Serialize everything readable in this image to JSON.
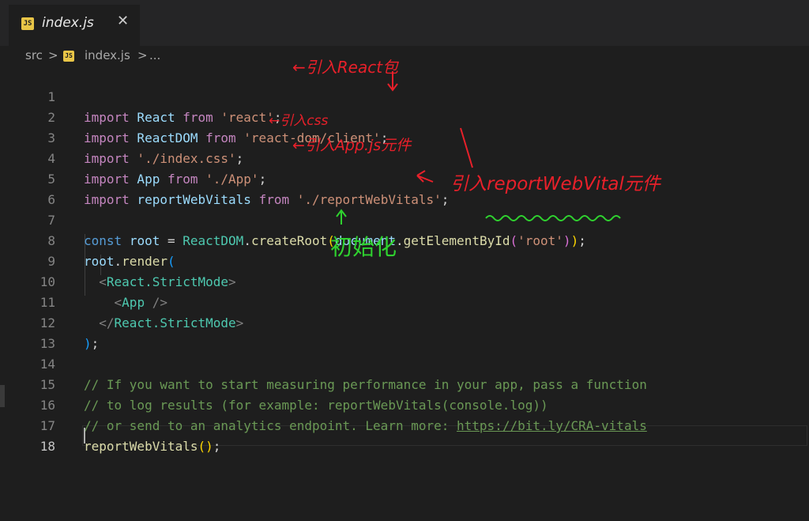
{
  "tab": {
    "badge": "JS",
    "label": "index.js",
    "close": "✕"
  },
  "breadcrumb": {
    "folder": "src",
    "sep1": ">",
    "file": "index.js",
    "sep2": ">",
    "more": "..."
  },
  "lines": [
    {
      "n": "1"
    },
    {
      "n": "2"
    },
    {
      "n": "3"
    },
    {
      "n": "4"
    },
    {
      "n": "5"
    },
    {
      "n": "6"
    },
    {
      "n": "7"
    },
    {
      "n": "8"
    },
    {
      "n": "9"
    },
    {
      "n": "10"
    },
    {
      "n": "11"
    },
    {
      "n": "12"
    },
    {
      "n": "13"
    },
    {
      "n": "14"
    },
    {
      "n": "15"
    },
    {
      "n": "16"
    },
    {
      "n": "17"
    },
    {
      "n": "18"
    }
  ],
  "code": {
    "l1": {
      "kw1": "import",
      "id": " React ",
      "kw2": "from",
      "str": " 'react'",
      "end": ";"
    },
    "l2": {
      "kw1": "import",
      "id": " ReactDOM ",
      "kw2": "from",
      "str": " 'react-dom/client'",
      "end": ";"
    },
    "l3": {
      "kw1": "import",
      "str": " './index.css'",
      "end": ";"
    },
    "l4": {
      "kw1": "import",
      "id": " App ",
      "kw2": "from",
      "str": " './App'",
      "end": ";"
    },
    "l5": {
      "kw1": "import",
      "id": " reportWebVitals ",
      "kw2": "from",
      "str": " './reportWebVitals'",
      "end": ";"
    },
    "l7": {
      "kw": "const",
      "sp1": " ",
      "var": "root",
      "eq": " = ",
      "obj": "ReactDOM",
      "dot": ".",
      "fn": "createRoot",
      "p1": "(",
      "doc": "document",
      "dot2": ".",
      "fn2": "getElementById",
      "p2": "(",
      "str": "'root'",
      "p2c": ")",
      "p1c": ")",
      "end": ";"
    },
    "l8": {
      "var": "root",
      "dot": ".",
      "fn": "render",
      "p": "("
    },
    "l9": {
      "sp": "  ",
      "open": "<",
      "comp": "React.StrictMode",
      "close": ">"
    },
    "l10": {
      "sp": "    ",
      "open": "<",
      "comp": "App",
      "close": " />"
    },
    "l11": {
      "sp": "  ",
      "open": "</",
      "comp": "React.StrictMode",
      "close": ">"
    },
    "l12": {
      "p": ")",
      "end": ";"
    },
    "l14": "// If you want to start measuring performance in your app, pass a function",
    "l15": "// to log results (for example: reportWebVitals(console.log))",
    "l16": {
      "text": "// or send to an analytics endpoint. Learn more: ",
      "link": "https://bit.ly/CRA-vitals"
    },
    "l17": {
      "fn": "reportWebVitals",
      "p": "()",
      "end": ";"
    }
  },
  "annotations": {
    "a1": "←引入React包",
    "a3": "←引入css",
    "a4": "←引入App.js元件",
    "a5": "引入reportWebVital元件",
    "a8": "初始化"
  },
  "colors": {
    "background": "#1e1e1e",
    "annotation_red": "#e8202a",
    "annotation_green": "#2fd22f"
  }
}
